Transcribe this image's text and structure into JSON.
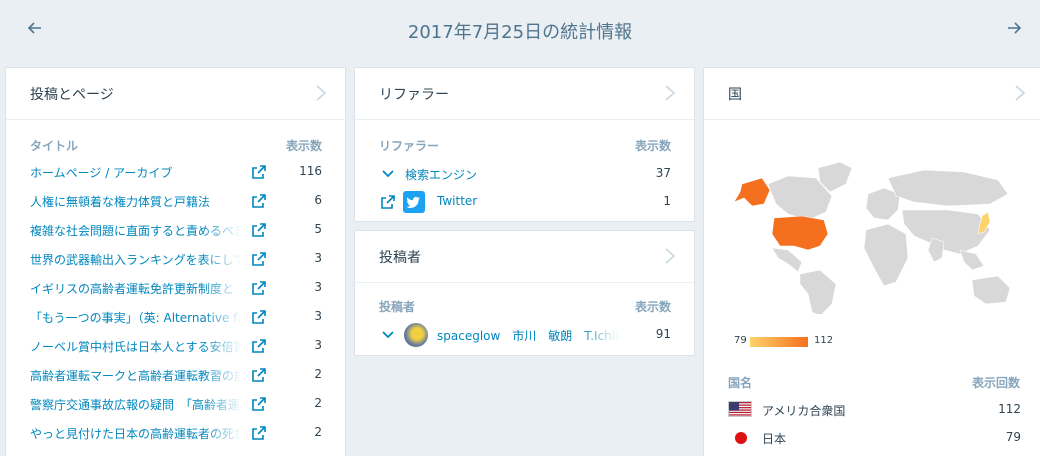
{
  "header": {
    "title": "2017年7月25日の統計情報",
    "prev_icon": "arrow-left-icon",
    "next_icon": "arrow-right-icon"
  },
  "posts": {
    "title": "投稿とページ",
    "col_title": "タイトル",
    "col_views": "表示数",
    "rows": [
      {
        "label": "ホームページ / アーカイブ",
        "views": "116"
      },
      {
        "label": "人権に無頓着な権力体質と戸籍法",
        "views": "6"
      },
      {
        "label": "複雑な社会問題に直面すると責めるべき",
        "views": "5"
      },
      {
        "label": "世界の武器輸出入ランキングを表にして",
        "views": "3"
      },
      {
        "label": "イギリスの高齢者運転免許更新制度と",
        "views": "3"
      },
      {
        "label": "「もう一つの事実」（英: Alternative facts",
        "views": "3"
      },
      {
        "label": "ノーベル賞中村氏は日本人とする安倍首",
        "views": "3"
      },
      {
        "label": "高齢者運転マークと高齢者運転教習の誤",
        "views": "2"
      },
      {
        "label": "警察庁交通事故広報の疑問　「高齢者運",
        "views": "2"
      },
      {
        "label": "やっと見付けた日本の高齢運転者の死亡",
        "views": "2"
      }
    ]
  },
  "referrers": {
    "title": "リファラー",
    "col_title": "リファラー",
    "col_views": "表示数",
    "rows": [
      {
        "label": "検索エンジン",
        "views": "37"
      },
      {
        "label": "Twitter",
        "views": "1"
      }
    ]
  },
  "authors": {
    "title": "投稿者",
    "col_title": "投稿者",
    "col_views": "表示数",
    "rows": [
      {
        "label": "spaceglow　市川　敏朗　T.Ichikawa",
        "views": "91"
      }
    ]
  },
  "countries": {
    "title": "国",
    "legend_min": "79",
    "legend_max": "112",
    "col_title": "国名",
    "col_views": "表示回数",
    "rows": [
      {
        "label": "アメリカ合衆国",
        "views": "112"
      },
      {
        "label": "日本",
        "views": "79"
      }
    ]
  },
  "colors": {
    "link": "#0087be",
    "accent_max": "#f4701e",
    "accent_min": "#fdd36a",
    "map_land": "#d8d8d8"
  }
}
